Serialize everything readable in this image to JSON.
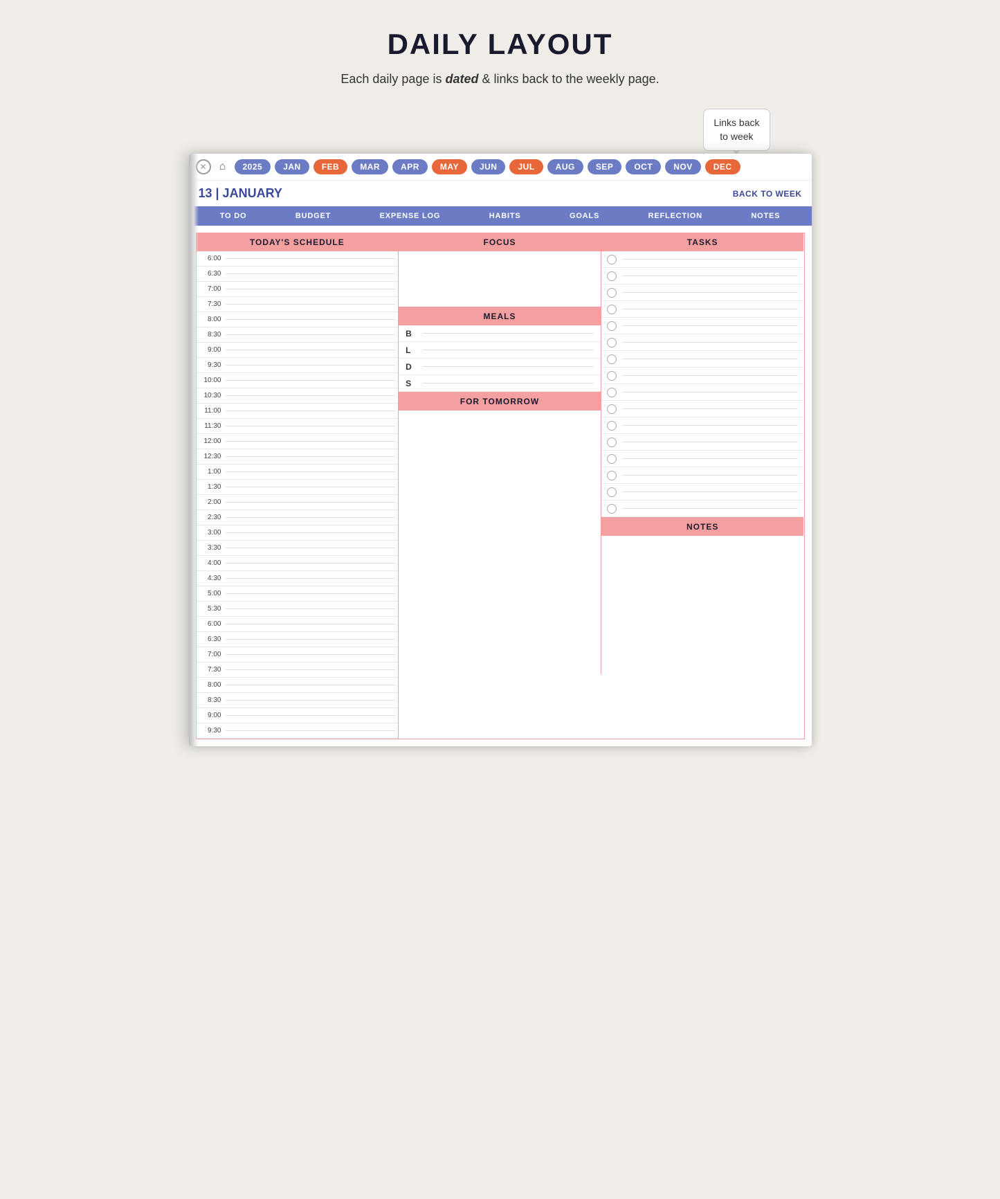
{
  "page": {
    "title": "DAILY LAYOUT",
    "subtitle_pre": "Each daily page is ",
    "subtitle_bold": "dated",
    "subtitle_post": " & links back to the weekly page.",
    "tooltip": "Links back\nto week"
  },
  "month_nav": {
    "year": "2025",
    "months": [
      {
        "label": "JAN",
        "style": "blue"
      },
      {
        "label": "FEB",
        "style": "orange"
      },
      {
        "label": "MAR",
        "style": "blue"
      },
      {
        "label": "APR",
        "style": "blue"
      },
      {
        "label": "MAY",
        "style": "orange"
      },
      {
        "label": "JUN",
        "style": "blue"
      },
      {
        "label": "JUL",
        "style": "orange"
      },
      {
        "label": "AUG",
        "style": "blue"
      },
      {
        "label": "SEP",
        "style": "blue"
      },
      {
        "label": "OCT",
        "style": "blue"
      },
      {
        "label": "NOV",
        "style": "blue"
      },
      {
        "label": "DEC",
        "style": "orange"
      }
    ]
  },
  "date_header": {
    "date": "13 | JANUARY",
    "back_label": "BACK TO WEEK"
  },
  "nav_tabs": [
    "TO DO",
    "BUDGET",
    "EXPENSE LOG",
    "HABITS",
    "GOALS",
    "REFLECTION",
    "NOTES"
  ],
  "sections": {
    "schedule_header": "TODAY'S SCHEDULE",
    "focus_header": "FOCUS",
    "tasks_header": "TASKS",
    "meals_header": "MEALS",
    "for_tomorrow_header": "FOR TOMORROW",
    "notes_header": "NOTES"
  },
  "meals": [
    {
      "label": "B"
    },
    {
      "label": "L"
    },
    {
      "label": "D"
    },
    {
      "label": "S"
    }
  ],
  "times": [
    "6:00",
    "6:30",
    "7:00",
    "7:30",
    "8:00",
    "8:30",
    "9:00",
    "9:30",
    "10:00",
    "10:30",
    "11:00",
    "11:30",
    "12:00",
    "12:30",
    "1:00",
    "1:30",
    "2:00",
    "2:30",
    "3:00",
    "3:30",
    "4:00",
    "4:30",
    "5:00",
    "5:30",
    "6:00",
    "6:30",
    "7:00",
    "7:30",
    "8:00",
    "8:30",
    "9:00",
    "9:30"
  ],
  "tasks_count": 16
}
